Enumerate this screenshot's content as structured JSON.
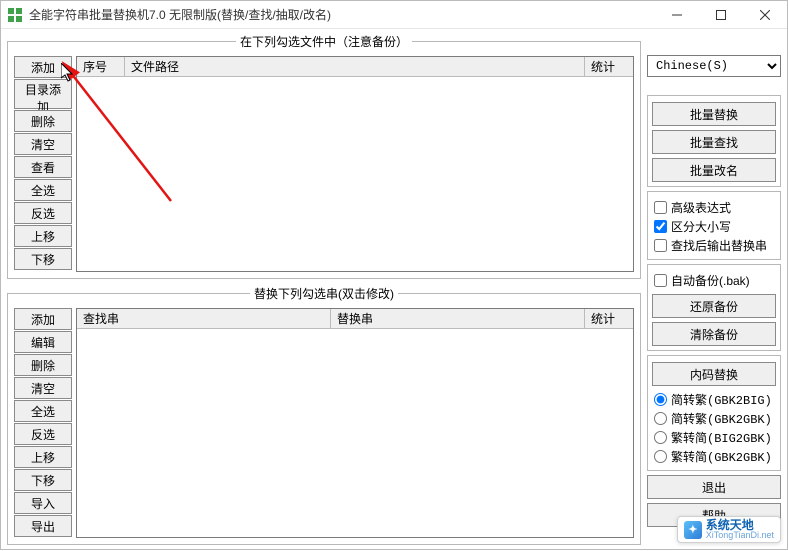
{
  "titlebar": {
    "title": "全能字符串批量替换机7.0 无限制版(替换/查找/抽取/改名)"
  },
  "groups": {
    "files": {
      "legend": "在下列勾选文件中（注意备份）"
    },
    "strings": {
      "legend": "替换下列勾选串(双击修改)"
    }
  },
  "fileButtons": {
    "add": "添加",
    "addDir": "目录添加",
    "delete": "删除",
    "clear": "清空",
    "view": "查看",
    "selectAll": "全选",
    "invert": "反选",
    "moveUp": "上移",
    "moveDown": "下移"
  },
  "fileColumns": {
    "index": "序号",
    "path": "文件路径",
    "stat": "统计"
  },
  "stringButtons": {
    "add": "添加",
    "edit": "编辑",
    "delete": "删除",
    "clear": "清空",
    "selectAll": "全选",
    "invert": "反选",
    "moveUp": "上移",
    "moveDown": "下移",
    "import": "导入",
    "export": "导出"
  },
  "stringColumns": {
    "find": "查找串",
    "replace": "替换串",
    "stat": "统计"
  },
  "right": {
    "langSelected": "Chinese(S)",
    "batchReplace": "批量替换",
    "batchFind": "批量查找",
    "batchRename": "批量改名",
    "advRegex": "高级表达式",
    "caseSensitive": "区分大小写",
    "outputAfterFind": "查找后输出替换串",
    "autoBackup": "自动备份(.bak)",
    "restoreBackup": "还原备份",
    "clearBackup": "清除备份",
    "encodingReplace": "内码替换",
    "enc1": "简转繁(GBK2BIG)",
    "enc2": "简转繁(GBK2GBK)",
    "enc3": "繁转简(BIG2GBK)",
    "enc4": "繁转简(GBK2GBK)",
    "exit": "退出",
    "help": "帮助"
  },
  "watermark": {
    "name": "系统天地",
    "url": "XiTongTianDi.net"
  }
}
